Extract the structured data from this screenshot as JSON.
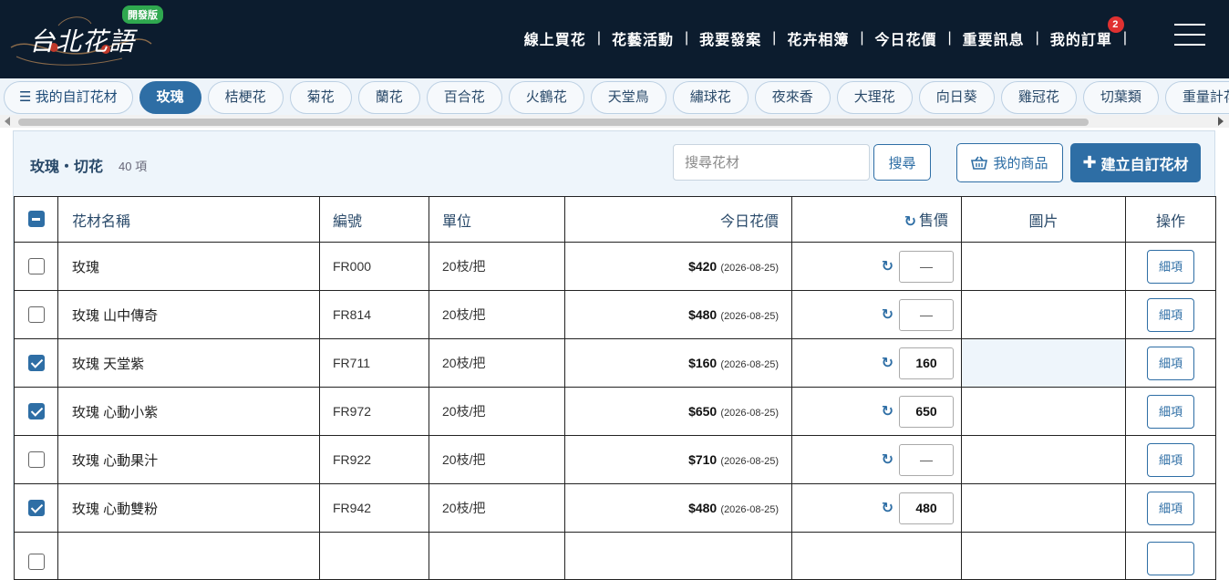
{
  "header": {
    "logo_text": "台北花語",
    "dev_badge": "開發版",
    "nav": [
      "線上買花",
      "花藝活動",
      "我要發案",
      "花卉相簿",
      "今日花價",
      "重要訊息",
      "我的訂單"
    ],
    "nav_sep": "|",
    "order_count": "2"
  },
  "tabs": {
    "custom_label": "我的自訂花材",
    "items": [
      "玫瑰",
      "桔梗花",
      "菊花",
      "蘭花",
      "百合花",
      "火鶴花",
      "天堂鳥",
      "繡球花",
      "夜來香",
      "大理花",
      "向日葵",
      "雞冠花",
      "切葉類",
      "重量計花"
    ],
    "active": "玫瑰"
  },
  "panel": {
    "title": "玫瑰・切花",
    "count": "40 項",
    "search_placeholder": "搜尋花材",
    "search_button": "搜尋",
    "my_products": "我的商品",
    "create_custom": "建立自訂花材"
  },
  "table": {
    "headers": {
      "name": "花材名稱",
      "code": "編號",
      "unit": "單位",
      "today_price": "今日花價",
      "sell_price": "售價",
      "image": "圖片",
      "action": "操作"
    },
    "rows": [
      {
        "checked": false,
        "name": "玫瑰",
        "code": "FR000",
        "unit": "20枝/把",
        "price": "$420",
        "date": "(2026-08-25)",
        "sell": "—",
        "detail": "細項"
      },
      {
        "checked": false,
        "name": "玫瑰 山中傳奇",
        "code": "FR814",
        "unit": "20枝/把",
        "price": "$480",
        "date": "(2026-08-25)",
        "sell": "—",
        "detail": "細項"
      },
      {
        "checked": true,
        "name": "玫瑰 天堂紫",
        "code": "FR711",
        "unit": "20枝/把",
        "price": "$160",
        "date": "(2026-08-25)",
        "sell": "160",
        "detail": "細項"
      },
      {
        "checked": true,
        "name": "玫瑰 心動小紫",
        "code": "FR972",
        "unit": "20枝/把",
        "price": "$650",
        "date": "(2026-08-25)",
        "sell": "650",
        "detail": "細項"
      },
      {
        "checked": false,
        "name": "玫瑰 心動果汁",
        "code": "FR922",
        "unit": "20枝/把",
        "price": "$710",
        "date": "(2026-08-25)",
        "sell": "—",
        "detail": "細項"
      },
      {
        "checked": true,
        "name": "玫瑰 心動雙粉",
        "code": "FR942",
        "unit": "20枝/把",
        "price": "$480",
        "date": "(2026-08-25)",
        "sell": "480",
        "detail": "細項"
      }
    ]
  },
  "colors": {
    "header_bg": "#0c1c2e",
    "accent": "#2e6ea5",
    "badge_green": "#2fa84f",
    "badge_red": "#e03131"
  }
}
